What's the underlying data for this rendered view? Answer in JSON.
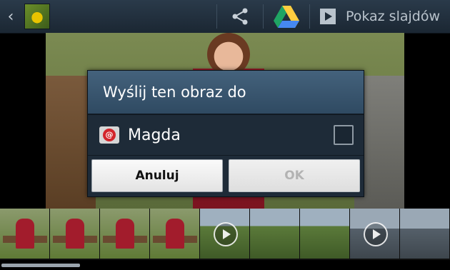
{
  "topbar": {
    "back_icon": "chevron-left-icon",
    "share_icon": "share-icon",
    "drive_icon": "google-drive-icon",
    "slideshow_label": "Pokaz slajdów",
    "slideshow_icon": "play-icon"
  },
  "dialog": {
    "title": "Wyślij ten obraz do",
    "option_label": "Magda",
    "option_icon": "email-icon",
    "option_checked": false,
    "cancel_label": "Anuluj",
    "ok_label": "OK"
  },
  "filmstrip": {
    "thumbnails": [
      {
        "kind": "photo",
        "selected": true
      },
      {
        "kind": "photo"
      },
      {
        "kind": "photo"
      },
      {
        "kind": "photo"
      },
      {
        "kind": "video"
      },
      {
        "kind": "photo"
      },
      {
        "kind": "photo"
      },
      {
        "kind": "video"
      },
      {
        "kind": "photo"
      }
    ]
  },
  "colors": {
    "accent": "#2a9fd8",
    "dialog_bg": "#1e2b38",
    "title_bg": "#3a5670",
    "email_red": "#d3252b",
    "drive_green": "#1fa463",
    "drive_yellow": "#ffcd40",
    "drive_blue": "#4688f1"
  }
}
